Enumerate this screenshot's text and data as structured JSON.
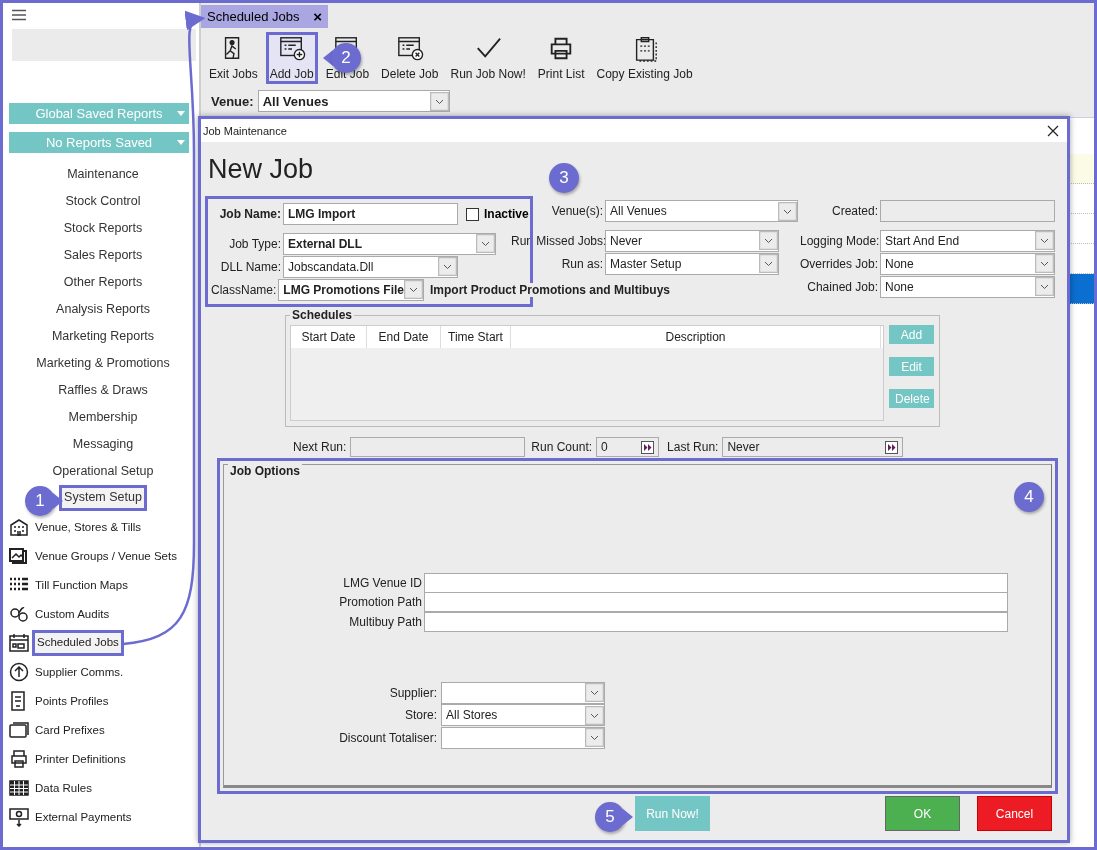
{
  "sidebar": {
    "saved_reports": [
      {
        "label": "Global Saved Reports"
      },
      {
        "label": "No Reports Saved"
      }
    ],
    "menu_items": [
      {
        "label": "Maintenance",
        "highlighted": false
      },
      {
        "label": "Stock Control",
        "highlighted": false
      },
      {
        "label": "Stock Reports",
        "highlighted": false
      },
      {
        "label": "Sales Reports",
        "highlighted": false
      },
      {
        "label": "Other Reports",
        "highlighted": false
      },
      {
        "label": "Analysis Reports",
        "highlighted": false
      },
      {
        "label": "Marketing Reports",
        "highlighted": false
      },
      {
        "label": "Marketing & Promotions",
        "highlighted": false
      },
      {
        "label": "Raffles & Draws",
        "highlighted": false
      },
      {
        "label": "Membership",
        "highlighted": false
      },
      {
        "label": "Messaging",
        "highlighted": false
      },
      {
        "label": "Operational Setup",
        "highlighted": false
      },
      {
        "label": "System Setup",
        "highlighted": true
      }
    ],
    "setup_items": [
      {
        "label": "Venue, Stores & Tills",
        "highlighted": false
      },
      {
        "label": "Venue Groups / Venue Sets",
        "highlighted": false
      },
      {
        "label": "Till Function Maps",
        "highlighted": false
      },
      {
        "label": "Custom Audits",
        "highlighted": false
      },
      {
        "label": "Scheduled Jobs",
        "highlighted": true
      },
      {
        "label": "Supplier Comms.",
        "highlighted": false
      },
      {
        "label": "Points Profiles",
        "highlighted": false
      },
      {
        "label": "Card Prefixes",
        "highlighted": false
      },
      {
        "label": "Printer Definitions",
        "highlighted": false
      },
      {
        "label": "Data Rules",
        "highlighted": false
      },
      {
        "label": "External Payments",
        "highlighted": false
      }
    ]
  },
  "tab": {
    "label": "Scheduled Jobs",
    "close": "×",
    "selected": true
  },
  "toolbar": [
    {
      "label": "Exit Jobs",
      "highlighted": false
    },
    {
      "label": "Add Job",
      "highlighted": true
    },
    {
      "label": "Edit Job",
      "highlighted": false
    },
    {
      "label": "Delete Job",
      "highlighted": false
    },
    {
      "label": "Run Job Now!",
      "highlighted": false
    },
    {
      "label": "Print List",
      "highlighted": false
    },
    {
      "label": "Copy Existing Job",
      "highlighted": false
    }
  ],
  "venue": {
    "label": "Venue:",
    "value": "All Venues"
  },
  "background_grid": {
    "rows": [
      {
        "selected": false
      },
      {
        "selected": false
      },
      {
        "selected": false
      },
      {
        "selected": false
      },
      {
        "selected": true
      }
    ]
  },
  "dialog": {
    "title": "Job Maintenance",
    "highlighted": true,
    "heading": "New Job",
    "job_form": {
      "highlighted": true,
      "job_name": {
        "label": "Job Name:",
        "value": "LMG Import"
      },
      "inactive": {
        "label": "Inactive",
        "checked": false
      },
      "job_type": {
        "label": "Job Type:",
        "value": "External DLL"
      },
      "dll_name": {
        "label": "DLL Name:",
        "value": "Jobscandata.Dll"
      },
      "class_name": {
        "label": "ClassName:",
        "value": "LMG Promotions File"
      },
      "class_description": "Import Product Promotions and Multibuys"
    },
    "venues": {
      "label": "Venue(s):",
      "value": "All Venues"
    },
    "run_missed_jobs": {
      "label": "Run Missed Jobs:",
      "value": "Never"
    },
    "run_as": {
      "label": "Run as:",
      "value": "Master Setup"
    },
    "created": {
      "label": "Created:"
    },
    "logging_mode": {
      "label": "Logging Mode:",
      "value": "Start And End"
    },
    "overrides_job": {
      "label": "Overrides Job:",
      "value": "None"
    },
    "chained_job": {
      "label": "Chained Job:",
      "value": "None"
    },
    "schedules": {
      "title": "Schedules",
      "columns": [
        "Start Date",
        "End Date",
        "Time Start",
        "Description"
      ],
      "buttons": [
        "Add",
        "Edit",
        "Delete"
      ]
    },
    "next_run": {
      "label": "Next Run:"
    },
    "run_count": {
      "label": "Run Count:",
      "value": "0"
    },
    "last_run": {
      "label": "Last Run:",
      "value": "Never"
    },
    "job_options": {
      "title": "Job Options",
      "highlighted": true,
      "text_fields": [
        {
          "label": "LMG Venue ID"
        },
        {
          "label": "Promotion Path"
        },
        {
          "label": "Multibuy Path"
        }
      ],
      "combos": [
        {
          "label": "Supplier:"
        },
        {
          "label": "Store:",
          "value": "All Stores"
        },
        {
          "label": "Discount Totaliser:"
        }
      ]
    },
    "buttons": [
      {
        "label": "Run Now!",
        "kind": "run"
      },
      {
        "label": "OK",
        "kind": "ok"
      },
      {
        "label": "Cancel",
        "kind": "cancel"
      }
    ]
  },
  "annotations": [
    {
      "label": "1"
    },
    {
      "label": "2"
    },
    {
      "label": "3"
    },
    {
      "label": "4"
    },
    {
      "label": "5"
    }
  ]
}
